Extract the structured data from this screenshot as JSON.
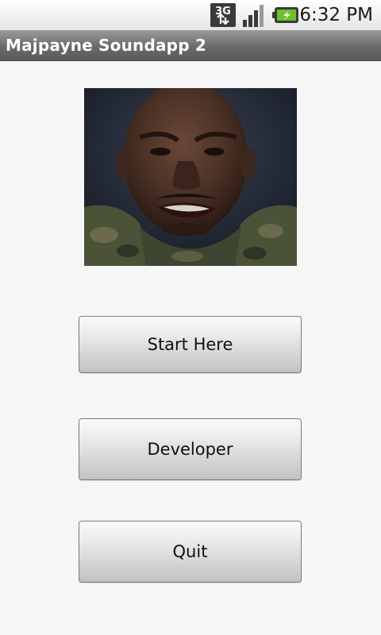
{
  "status_bar": {
    "network_label": "3G",
    "icons": [
      "network-3g-icon",
      "signal-strength-icon",
      "battery-charging-icon"
    ],
    "time": "6:32 PM"
  },
  "app": {
    "title": "Majpayne Soundapp 2"
  },
  "main": {
    "image": "portrait-photo",
    "buttons": [
      {
        "label": "Start Here"
      },
      {
        "label": "Developer"
      },
      {
        "label": "Quit"
      }
    ]
  },
  "colors": {
    "background": "#f6f6f6",
    "title_bar": "#6b6b6b",
    "battery_green": "#6ec12c"
  }
}
